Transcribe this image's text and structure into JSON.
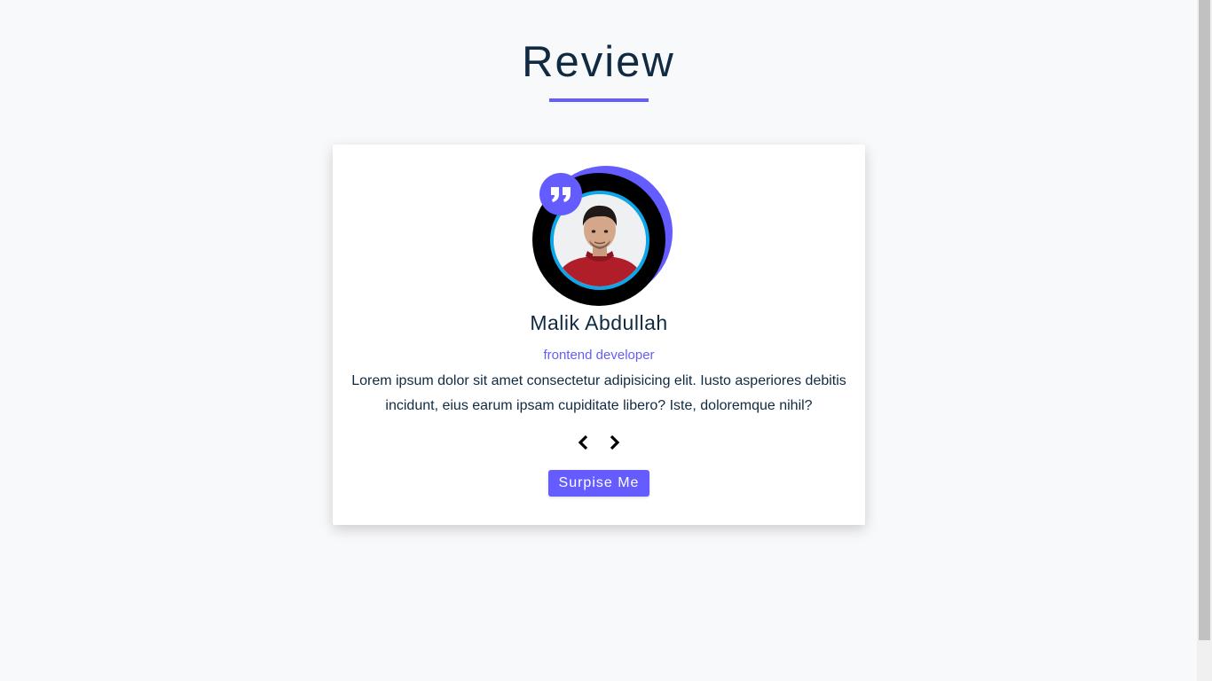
{
  "header": {
    "title": "Review"
  },
  "review": {
    "name": "Malik Abdullah",
    "job": "frontend developer",
    "text": "Lorem ipsum dolor sit amet consectetur adipisicing elit. Iusto asperiores debitis incidunt, eius earum ipsam cupiditate libero? Iste, doloremque nihil?",
    "photo_alt": "Malik Abdullah"
  },
  "controls": {
    "prev_icon": "chevron-left-icon",
    "next_icon": "chevron-right-icon",
    "random_label": "Surpise Me"
  },
  "colors": {
    "accent": "#645cff",
    "ring": "#0ea5e9",
    "text": "#102a42",
    "background": "#f8f9fb"
  }
}
